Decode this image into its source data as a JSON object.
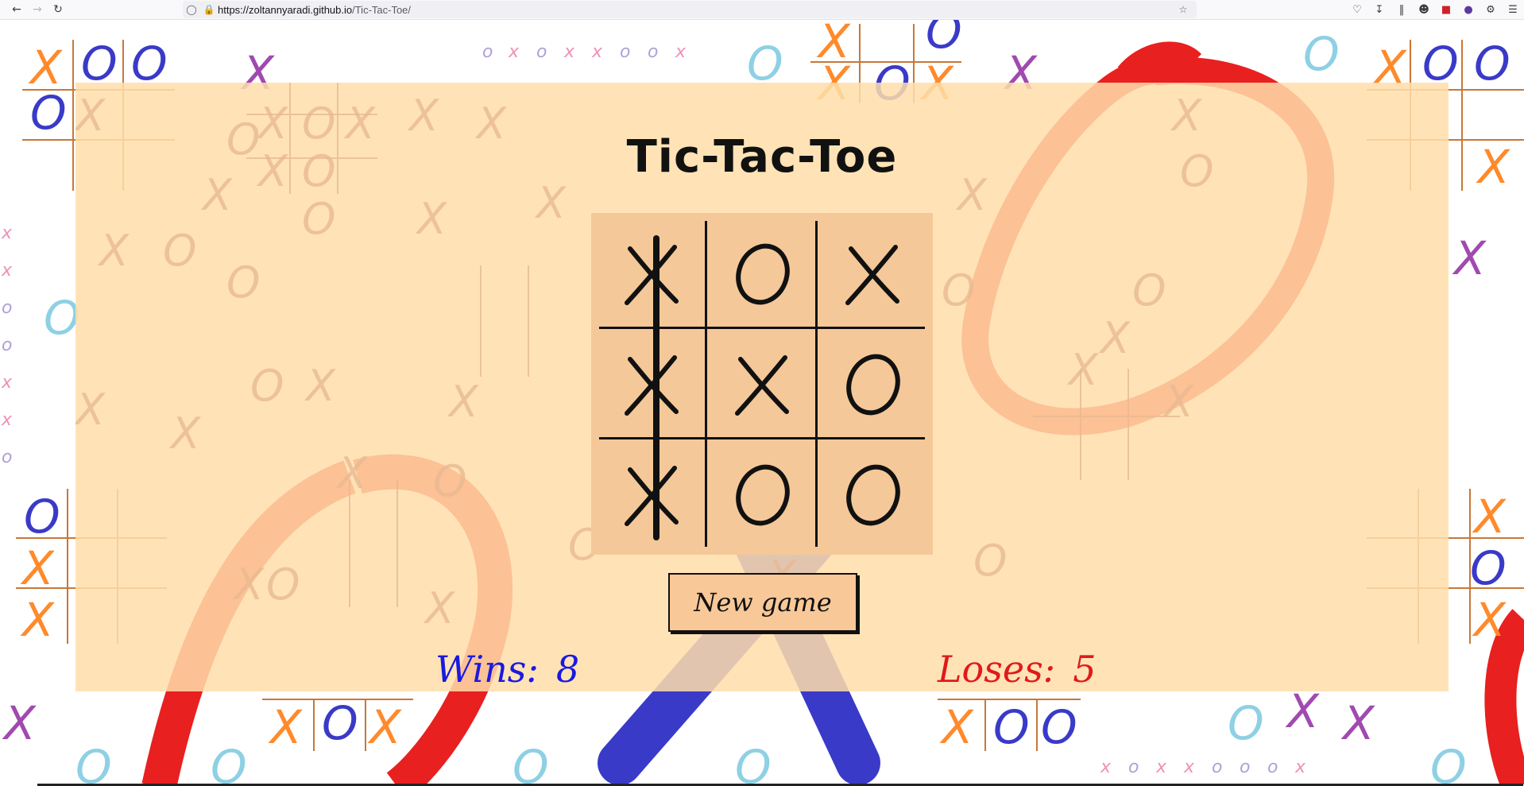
{
  "browser": {
    "url_host": "https://zoltannyaradi.github.io",
    "url_path": "/Tic-Tac-Toe/",
    "icons": [
      "back-icon",
      "forward-icon",
      "reload-icon",
      "shield-icon",
      "lock-icon",
      "bookmark-star-icon",
      "pocket-icon",
      "downloads-icon",
      "library-icon",
      "account-icon",
      "extension-ublock-icon",
      "extension-profile-icon",
      "extensions-icon",
      "menu-icon"
    ]
  },
  "game": {
    "title": "Tic-Tac-Toe",
    "board": [
      "X",
      "O",
      "X",
      "X",
      "X",
      "O",
      "X",
      "O",
      "O"
    ],
    "winning_line": "column-1",
    "new_game_label": "New game",
    "wins_label": "Wins:",
    "wins_value": "8",
    "loses_label": "Loses:",
    "loses_value": "5"
  },
  "colors": {
    "panel": "#ffdeaa",
    "board": "#f4c898",
    "wins": "#1a1ae0",
    "loses": "#e01a1a",
    "bg_orange": "#ff8a2b",
    "bg_blue": "#3a3ac8",
    "bg_purple": "#a04ab0",
    "bg_red": "#e82020",
    "bg_cyan": "#8ed0e4",
    "bg_pink": "#f090b8"
  }
}
